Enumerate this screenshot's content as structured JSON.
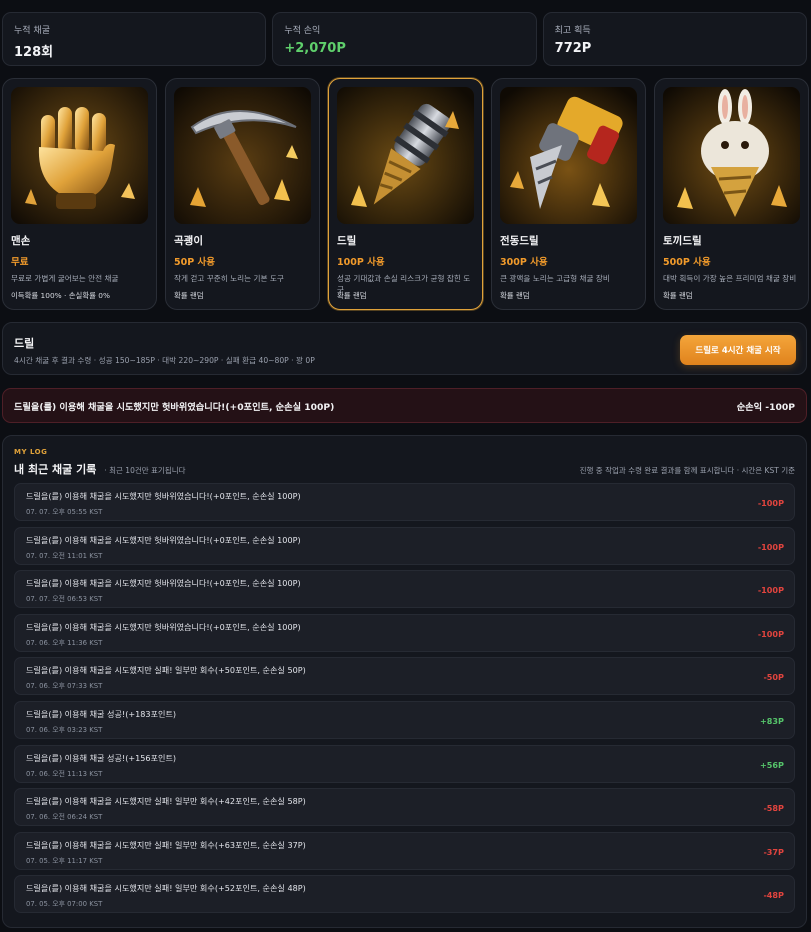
{
  "stats": [
    {
      "label": "누적 채굴",
      "value": "128회"
    },
    {
      "label": "누적 손익",
      "value": "+2,070P"
    },
    {
      "label": "최고 획득",
      "value": "772P"
    }
  ],
  "tools": [
    {
      "name": "맨손",
      "cost": "무료",
      "desc": "무료로 가볍게 굴어보는 안전 채굴",
      "note": "이득확률 100% · 손실확률 0%",
      "icon": "gold-glove-icon"
    },
    {
      "name": "곡괭이",
      "cost": "50P 사용",
      "desc": "작게 걷고 꾸준히 노리는 기본 도구",
      "note": "확률 랜덤",
      "icon": "pickaxe-icon"
    },
    {
      "name": "드릴",
      "cost": "100P 사용",
      "desc": "성공 기대값과 손실 리스크가 균형 잡힌 도구",
      "note": "확률 랜덤",
      "icon": "drill-icon"
    },
    {
      "name": "전동드릴",
      "cost": "300P 사용",
      "desc": "큰 광맥을 노리는 고급형 채굴 장비",
      "note": "확률 랜덤",
      "icon": "power-drill-icon"
    },
    {
      "name": "토끼드릴",
      "cost": "500P 사용",
      "desc": "대박 획득이 가장 높은 프리미엄 채굴 장비",
      "note": "확률 랜덤",
      "icon": "rabbit-drill-icon"
    }
  ],
  "selected": {
    "title": "드릴",
    "subtitle": "4시간 채굴 후 결과 수령 · 성공 150~185P · 대박 220~290P · 실패 환급 40~80P · 꽝 0P",
    "start_label": "드릴로 4시간 채굴 시작"
  },
  "result": {
    "message": "드릴을(를) 이용해 채굴을 시도했지만 헛바위였습니다!(+0포인트, 순손실 100P)",
    "net": "순손익 -100P"
  },
  "log": {
    "tag": "MY LOG",
    "title": "내 최근 채굴 기록",
    "subtitle": "· 최근 10건만 표기됩니다",
    "note": "진행 중 작업과 수령 완료 결과를 함께 표시합니다 · 시간은 KST 기준",
    "entries": [
      {
        "message": "드릴을(를) 이용해 채굴을 시도했지만 헛바위였습니다!(+0포인트, 순손실 100P)",
        "time": "07. 07. 오후 05:55 KST",
        "delta": "-100P",
        "sign": "neg"
      },
      {
        "message": "드릴을(를) 이용해 채굴을 시도했지만 헛바위였습니다!(+0포인트, 순손실 100P)",
        "time": "07. 07. 오전 11:01 KST",
        "delta": "-100P",
        "sign": "neg"
      },
      {
        "message": "드릴을(를) 이용해 채굴을 시도했지만 헛바위였습니다!(+0포인트, 순손실 100P)",
        "time": "07. 07. 오전 06:53 KST",
        "delta": "-100P",
        "sign": "neg"
      },
      {
        "message": "드릴을(를) 이용해 채굴을 시도했지만 헛바위였습니다!(+0포인트, 순손실 100P)",
        "time": "07. 06. 오후 11:36 KST",
        "delta": "-100P",
        "sign": "neg"
      },
      {
        "message": "드릴을(를) 이용해 채굴을 시도했지만 실패! 일부만 회수(+50포인트, 순손실 50P)",
        "time": "07. 06. 오후 07:33 KST",
        "delta": "-50P",
        "sign": "neg"
      },
      {
        "message": "드릴을(를) 이용해 채굴 성공!(+183포인트)",
        "time": "07. 06. 오후 03:23 KST",
        "delta": "+83P",
        "sign": "pos"
      },
      {
        "message": "드릴을(를) 이용해 채굴 성공!(+156포인트)",
        "time": "07. 06. 오전 11:13 KST",
        "delta": "+56P",
        "sign": "pos"
      },
      {
        "message": "드릴을(를) 이용해 채굴을 시도했지만 실패! 일부만 회수(+42포인트, 순손실 58P)",
        "time": "07. 06. 오전 06:24 KST",
        "delta": "-58P",
        "sign": "neg"
      },
      {
        "message": "드릴을(를) 이용해 채굴을 시도했지만 실패! 일부만 회수(+63포인트, 순손실 37P)",
        "time": "07. 05. 오후 11:17 KST",
        "delta": "-37P",
        "sign": "neg"
      },
      {
        "message": "드릴을(를) 이용해 채굴을 시도했지만 실패! 일부만 회수(+52포인트, 순손실 48P)",
        "time": "07. 05. 오후 07:00 KST",
        "delta": "-48P",
        "sign": "neg"
      }
    ]
  },
  "colors": {
    "accent": "#f29b2b",
    "selected_border": "#e0a23a",
    "positive": "#55c46a",
    "negative": "#e2443e",
    "background": "#0c0e13"
  }
}
